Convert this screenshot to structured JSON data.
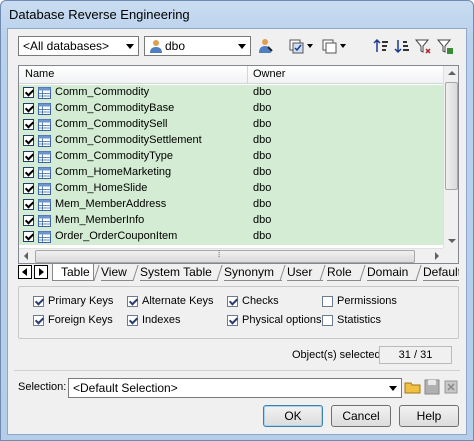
{
  "window": {
    "title": "Database Reverse Engineering"
  },
  "toolbar": {
    "database_combo": "<All databases>",
    "owner_combo": "dbo"
  },
  "list": {
    "columns": [
      "Name",
      "Owner"
    ],
    "rows": [
      {
        "name": "Comm_Commodity",
        "owner": "dbo"
      },
      {
        "name": "Comm_CommodityBase",
        "owner": "dbo"
      },
      {
        "name": "Comm_CommoditySell",
        "owner": "dbo"
      },
      {
        "name": "Comm_CommoditySettlement",
        "owner": "dbo"
      },
      {
        "name": "Comm_CommodityType",
        "owner": "dbo"
      },
      {
        "name": "Comm_HomeMarketing",
        "owner": "dbo"
      },
      {
        "name": "Comm_HomeSlide",
        "owner": "dbo"
      },
      {
        "name": "Mem_MemberAddress",
        "owner": "dbo"
      },
      {
        "name": "Mem_MemberInfo",
        "owner": "dbo"
      },
      {
        "name": "Order_OrderCouponItem",
        "owner": "dbo"
      }
    ],
    "row_color": "#d3ecd3"
  },
  "tabs": [
    "Table",
    "View",
    "System Table",
    "Synonym",
    "User",
    "Role",
    "Domain",
    "Default"
  ],
  "options": {
    "primary_keys": "Primary Keys",
    "foreign_keys": "Foreign Keys",
    "alternate_keys": "Alternate Keys",
    "indexes": "Indexes",
    "checks": "Checks",
    "physical_options": "Physical options",
    "permissions": "Permissions",
    "statistics": "Statistics"
  },
  "status": {
    "selected_label": "Object(s) selected:",
    "selected_value": "31 / 31"
  },
  "selection": {
    "label": "Selection:",
    "value": "<Default Selection>"
  },
  "buttons": {
    "ok": "OK",
    "cancel": "Cancel",
    "help": "Help"
  }
}
